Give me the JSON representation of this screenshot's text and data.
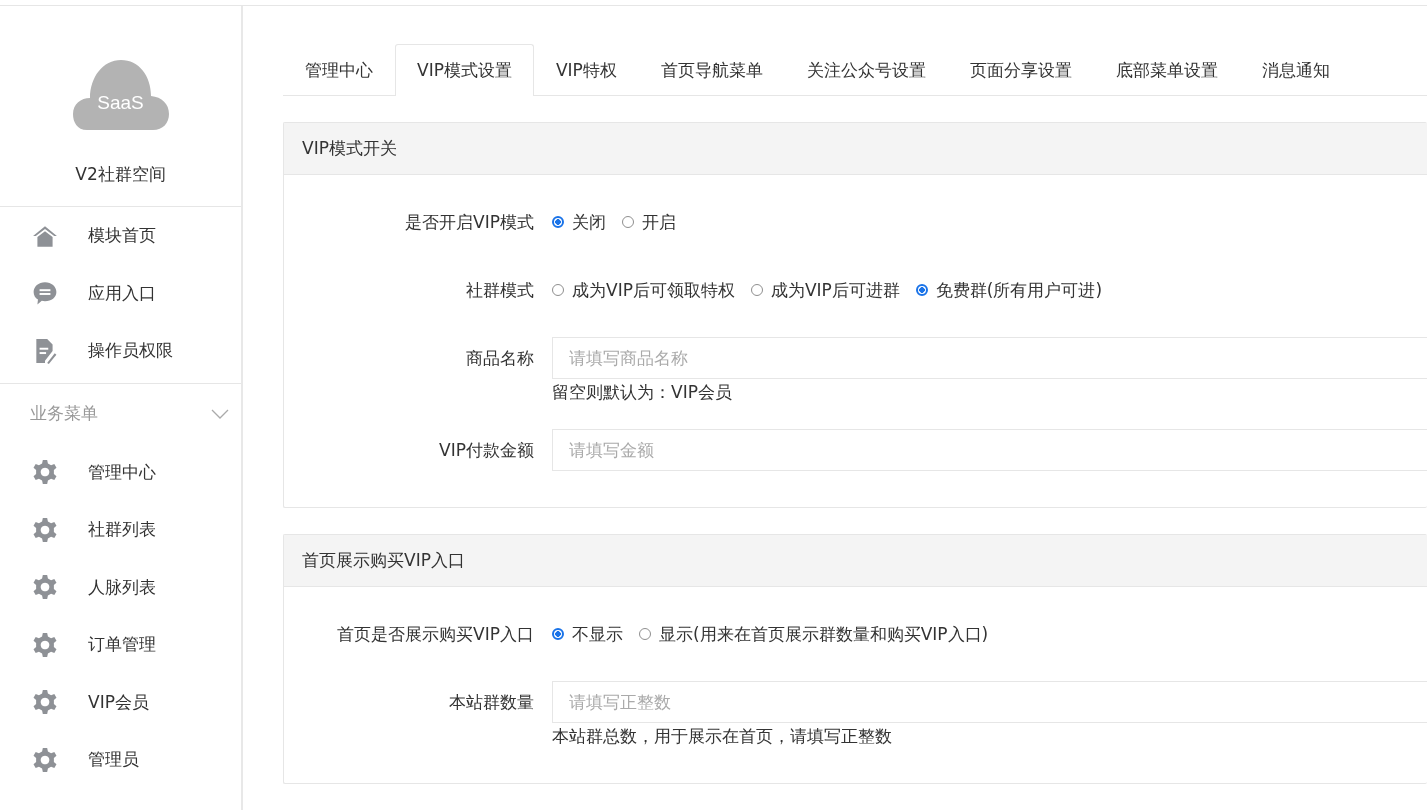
{
  "sidebar": {
    "logo_text": "SaaS",
    "name": "V2社群空间",
    "items": [
      {
        "label": "模块首页",
        "kind": "home"
      },
      {
        "label": "应用入口",
        "kind": "chat"
      },
      {
        "label": "操作员权限",
        "kind": "doc"
      }
    ],
    "section": {
      "title": "业务菜单",
      "expanded": true,
      "items": [
        {
          "label": "管理中心",
          "kind": "gear"
        },
        {
          "label": "社群列表",
          "kind": "gear"
        },
        {
          "label": "人脉列表",
          "kind": "gear"
        },
        {
          "label": "订单管理",
          "kind": "gear"
        },
        {
          "label": "VIP会员",
          "kind": "gear"
        },
        {
          "label": "管理员",
          "kind": "gear"
        }
      ]
    }
  },
  "tabs": [
    {
      "label": "管理中心",
      "selected": false
    },
    {
      "label": "VIP模式设置",
      "selected": true
    },
    {
      "label": "VIP特权",
      "selected": false
    },
    {
      "label": "首页导航菜单",
      "selected": false
    },
    {
      "label": "关注公众号设置",
      "selected": false
    },
    {
      "label": "页面分享设置",
      "selected": false
    },
    {
      "label": "底部菜单设置",
      "selected": false
    },
    {
      "label": "消息通知",
      "selected": false
    }
  ],
  "panels": [
    {
      "title": "VIP模式开关",
      "fields": [
        {
          "kind": "radio",
          "label": "是否开启VIP模式",
          "options": [
            {
              "label": "关闭",
              "selected": true
            },
            {
              "label": "开启",
              "selected": false
            }
          ]
        },
        {
          "kind": "radio",
          "label": "社群模式",
          "options": [
            {
              "label": "成为VIP后可领取特权",
              "selected": false
            },
            {
              "label": "成为VIP后可进群",
              "selected": false
            },
            {
              "label": "免费群(所有用户可进)",
              "selected": true
            }
          ]
        },
        {
          "kind": "input",
          "label": "商品名称",
          "placeholder": "请填写商品名称",
          "hint": "留空则默认为：VIP会员"
        },
        {
          "kind": "input",
          "label": "VIP付款金额",
          "placeholder": "请填写金额"
        }
      ]
    },
    {
      "title": "首页展示购买VIP入口",
      "fields": [
        {
          "kind": "radio",
          "label": "首页是否展示购买VIP入口",
          "options": [
            {
              "label": "不显示",
              "selected": true
            },
            {
              "label": "显示(用来在首页展示群数量和购买VIP入口)",
              "selected": false
            }
          ]
        },
        {
          "kind": "input",
          "label": "本站群数量",
          "placeholder": "请填写正整数",
          "hint": "本站群总数，用于展示在首页，请填写正整数"
        }
      ]
    }
  ]
}
